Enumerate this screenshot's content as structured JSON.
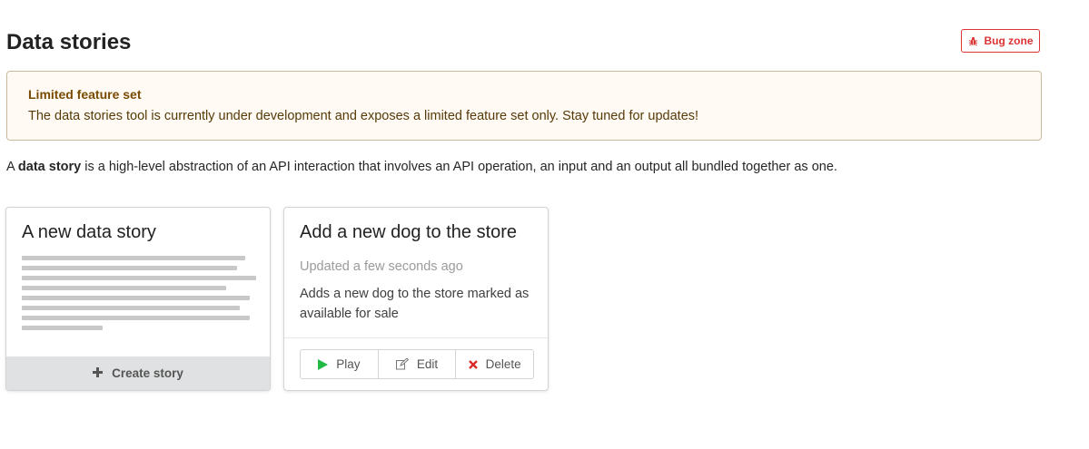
{
  "header": {
    "title": "Data stories",
    "bug_zone_label": "Bug zone",
    "bug_zone_icon": "bug-icon",
    "bug_zone_color": "#dd3333"
  },
  "notice": {
    "title": "Limited feature set",
    "body": "The data stories tool is currently under development and exposes a limited feature set only. Stay tuned for updates!"
  },
  "intro": {
    "prefix": "A ",
    "bold": "data story",
    "suffix": " is a high-level abstraction of an API interaction that involves an API operation, an input and an output all bundled together as one."
  },
  "new_story_card": {
    "title": "A new data story",
    "create_label": "Create story",
    "create_icon": "plus-icon"
  },
  "stories": [
    {
      "title": "Add a new dog to the store",
      "updated": "Updated a few seconds ago",
      "description": "Adds a new dog to the store marked as available for sale",
      "actions": {
        "play_label": "Play",
        "edit_label": "Edit",
        "delete_label": "Delete",
        "play_color": "#21ba45",
        "delete_color": "#db2828"
      }
    }
  ]
}
